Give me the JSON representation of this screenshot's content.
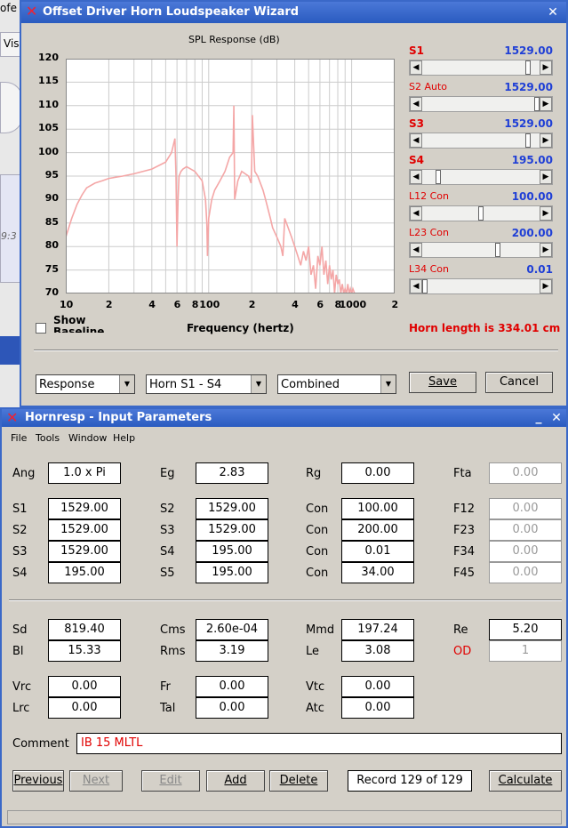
{
  "background": {
    "fragments": [
      "ofe",
      "Vis",
      "9:3"
    ]
  },
  "wizard": {
    "title": "Offset Driver Horn Loudspeaker Wizard",
    "close_glyph": "✕",
    "chart_title": "SPL Response (dB)",
    "xlabel": "Frequency (hertz)",
    "y_ticks": [
      "120",
      "115",
      "110",
      "105",
      "100",
      "95",
      "90",
      "85",
      "80",
      "75",
      "70"
    ],
    "x_ticks": [
      "10",
      "2",
      "4",
      "6",
      "8",
      "100",
      "2",
      "4",
      "6",
      "8",
      "1000",
      "2"
    ],
    "show_baseline": "Show Baseline",
    "horn_length": "Horn length is 334.01 cm",
    "sliders": [
      {
        "name": "S1",
        "value": "1529.00",
        "position": 0.92
      },
      {
        "name": "S2 Auto",
        "value": "1529.00",
        "position": 1.0
      },
      {
        "name": "S3",
        "value": "1529.00",
        "position": 0.92
      },
      {
        "name": "S4",
        "value": "195.00",
        "position": 0.12
      },
      {
        "name": "L12 Con",
        "value": "100.00",
        "position": 0.5
      },
      {
        "name": "L23 Con",
        "value": "200.00",
        "position": 0.65
      },
      {
        "name": "L34 Con",
        "value": "0.01",
        "position": 0.0
      }
    ],
    "combos": [
      "Response",
      "Horn S1 - S4",
      "Combined"
    ],
    "save_label": "Save",
    "cancel_label": "Cancel"
  },
  "chart_data": {
    "type": "line",
    "title": "SPL Response (dB)",
    "xlabel": "Frequency (hertz)",
    "ylabel": "",
    "xscale": "log",
    "xlim": [
      10,
      2000
    ],
    "ylim": [
      70,
      120
    ],
    "grid": true,
    "color": "#f4a6a6",
    "series": [
      {
        "x": [
          10,
          11,
          12,
          13,
          14,
          16,
          18,
          20,
          25,
          30,
          40,
          50,
          55,
          58,
          59,
          60,
          61,
          62,
          64,
          66,
          70,
          80,
          90,
          95,
          97,
          98,
          100,
          105,
          110,
          120,
          130,
          140,
          148,
          150,
          152,
          160,
          170,
          180,
          190,
          198,
          200,
          202,
          210,
          220,
          240,
          250,
          260,
          270,
          280,
          300,
          320,
          330,
          340,
          360,
          380,
          400,
          420,
          440,
          460,
          480,
          500,
          520,
          540,
          560,
          580,
          600,
          620,
          640,
          660,
          680,
          700,
          720,
          740,
          760,
          780,
          800,
          820,
          840,
          860,
          880,
          900,
          920,
          940,
          960,
          980,
          1000,
          1020,
          1050,
          1100,
          1150,
          1200
        ],
        "y": [
          82,
          86,
          89,
          91,
          92.5,
          93.5,
          94,
          94.5,
          95,
          95.5,
          96.5,
          98,
          100,
          103,
          95,
          80,
          90,
          95,
          96,
          96.5,
          97,
          96,
          94,
          90,
          85,
          78,
          86,
          90,
          92,
          94,
          96,
          99,
          100,
          110,
          90,
          94,
          96,
          95.5,
          95,
          93.5,
          98,
          108,
          96,
          95,
          92,
          90,
          88,
          86,
          84,
          82,
          80,
          78,
          86,
          84,
          82,
          80,
          78,
          76,
          79,
          77,
          80,
          74,
          76,
          71,
          78,
          76,
          80,
          74,
          77,
          72,
          76,
          73,
          75,
          70,
          74,
          72,
          73,
          70,
          72,
          70,
          71,
          70,
          72,
          70,
          71,
          70,
          71,
          70,
          70,
          70,
          70
        ]
      }
    ]
  },
  "input": {
    "title": "Hornresp - Input Parameters",
    "menu": [
      "File",
      "Tools",
      "Window",
      "Help"
    ],
    "fields": {
      "Ang": "1.0 x Pi",
      "Eg": "2.83",
      "Rg": "0.00",
      "Fta": "0.00",
      "S1": "1529.00",
      "S2": "1529.00",
      "Con1": "100.00",
      "F12": "0.00",
      "S2b": "1529.00",
      "S3": "1529.00",
      "Con2": "200.00",
      "F23": "0.00",
      "S3b": "1529.00",
      "S4": "195.00",
      "Con3": "0.01",
      "F34": "0.00",
      "S4b": "195.00",
      "S5": "195.00",
      "Con4": "34.00",
      "F45": "0.00",
      "Sd": "819.40",
      "Cms": "2.60e-04",
      "Mmd": "197.24",
      "Re": "5.20",
      "Bl": "15.33",
      "Rms": "3.19",
      "Le": "3.08",
      "OD": "1",
      "Vrc": "0.00",
      "Fr": "0.00",
      "Vtc": "0.00",
      "Lrc": "0.00",
      "Tal": "0.00",
      "Atc": "0.00"
    },
    "labels": {
      "Ang": "Ang",
      "Eg": "Eg",
      "Rg": "Rg",
      "Fta": "Fta",
      "S1": "S1",
      "S2": "S2",
      "S3": "S3",
      "S4": "S4",
      "S5": "S5",
      "Con": "Con",
      "F12": "F12",
      "F23": "F23",
      "F34": "F34",
      "F45": "F45",
      "Sd": "Sd",
      "Cms": "Cms",
      "Mmd": "Mmd",
      "Re": "Re",
      "Bl": "Bl",
      "Rms": "Rms",
      "Le": "Le",
      "OD": "OD",
      "Vrc": "Vrc",
      "Fr": "Fr",
      "Vtc": "Vtc",
      "Lrc": "Lrc",
      "Tal": "Tal",
      "Atc": "Atc",
      "Comment": "Comment"
    },
    "comment": "IB 15 MLTL",
    "buttons": {
      "previous": "Previous",
      "next": "Next",
      "edit": "Edit",
      "add": "Add",
      "delete": "Delete",
      "calculate": "Calculate"
    },
    "record": "Record 129 of 129",
    "minimize_glyph": "_",
    "close_glyph": "✕"
  }
}
